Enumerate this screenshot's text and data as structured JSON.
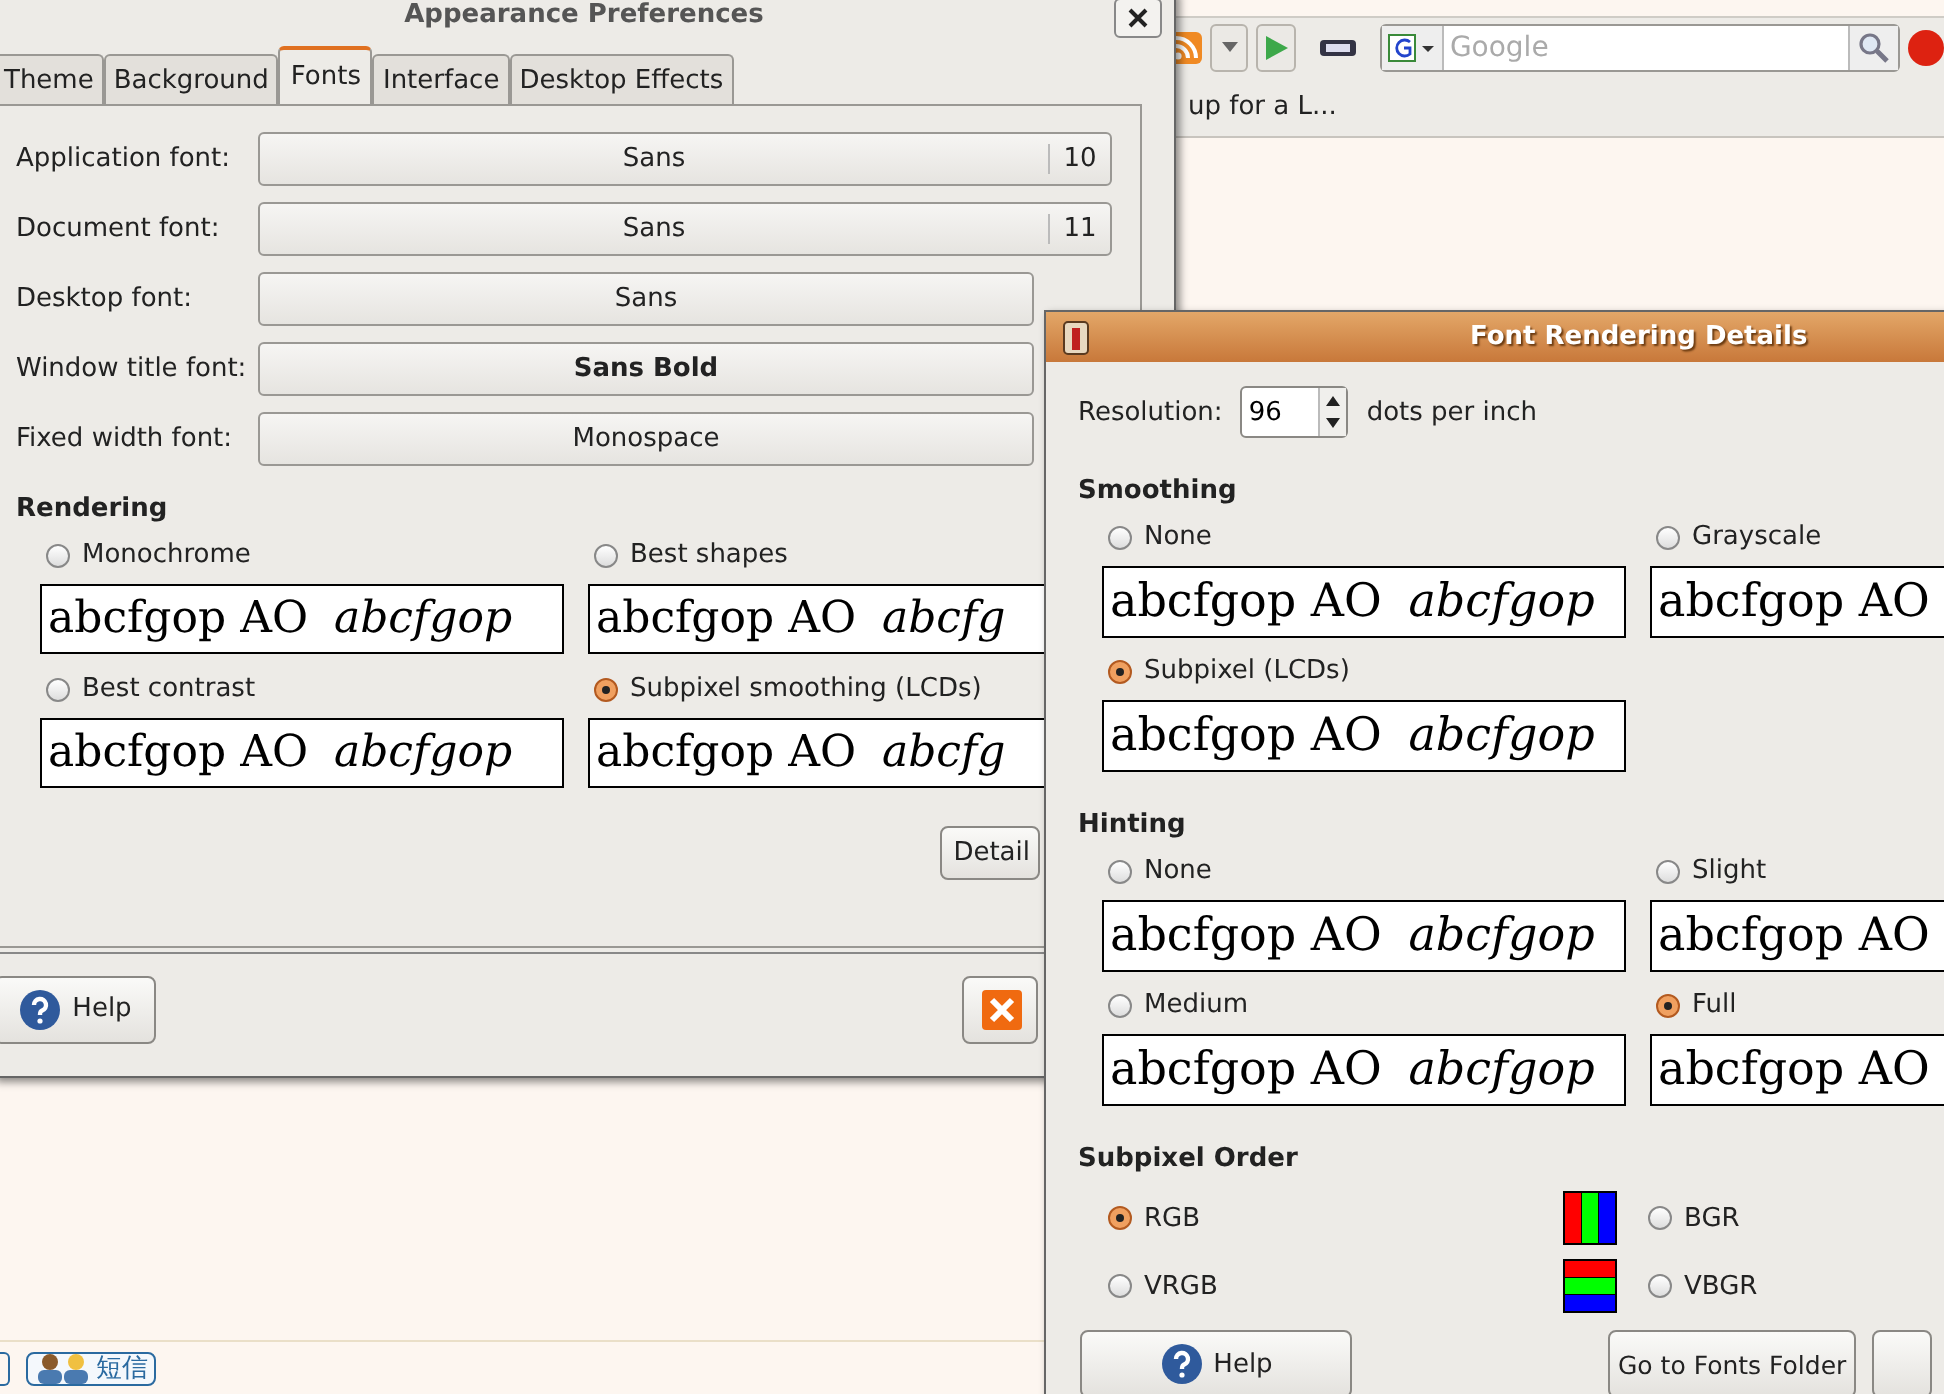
{
  "browser": {
    "search_placeholder": "Google",
    "bookmark": "up for a L...",
    "footer_button": "短信"
  },
  "prefs": {
    "title": "Appearance Preferences",
    "tabs": [
      {
        "label": "Theme",
        "selected": false
      },
      {
        "label": "Background",
        "selected": false
      },
      {
        "label": "Fonts",
        "selected": true
      },
      {
        "label": "Interface",
        "selected": false
      },
      {
        "label": "Desktop Effects",
        "selected": false
      }
    ],
    "fonts": [
      {
        "label": "Application font:",
        "value": "Sans",
        "size": "10",
        "bold": false
      },
      {
        "label": "Document font:",
        "value": "Sans",
        "size": "11",
        "bold": false
      },
      {
        "label": "Desktop font:",
        "value": "Sans",
        "bold": false
      },
      {
        "label": "Window title font:",
        "value": "Sans Bold",
        "bold": true
      },
      {
        "label": "Fixed width font:",
        "value": "Monospace",
        "bold": false
      }
    ],
    "rendering_heading": "Rendering",
    "rendering": [
      {
        "label": "Monochrome",
        "selected": false,
        "sample": "abcfgop AO",
        "sample_italic": "abcfgop"
      },
      {
        "label": "Best shapes",
        "selected": false,
        "sample": "abcfgop AO",
        "sample_italic": "abcfg"
      },
      {
        "label": "Best contrast",
        "selected": false,
        "sample": "abcfgop AO",
        "sample_italic": "abcfgop"
      },
      {
        "label": "Subpixel smoothing (LCDs)",
        "selected": true,
        "sample": "abcfgop AO",
        "sample_italic": "abcfg"
      }
    ],
    "details_button": "Detail",
    "help_button": "Help"
  },
  "details": {
    "title": "Font Rendering Details",
    "resolution_label": "Resolution:",
    "resolution": "96",
    "resolution_unit": "dots per inch",
    "sections": [
      {
        "heading": "Smoothing",
        "kind": "samples",
        "options": [
          {
            "label": "None",
            "selected": false,
            "sample": "abcfgop AO",
            "sample_italic": "abcfgop"
          },
          {
            "label": "Grayscale",
            "selected": false,
            "sample": "abcfgop AO"
          },
          {
            "label": "Subpixel (LCDs)",
            "selected": true,
            "sample": "abcfgop AO",
            "sample_italic": "abcfgop"
          }
        ]
      },
      {
        "heading": "Hinting",
        "kind": "samples",
        "options": [
          {
            "label": "None",
            "selected": false,
            "sample": "abcfgop AO",
            "sample_italic": "abcfgop"
          },
          {
            "label": "Slight",
            "selected": false,
            "sample": "abcfgop AO"
          },
          {
            "label": "Medium",
            "selected": false,
            "sample": "abcfgop AO",
            "sample_italic": "abcfgop"
          },
          {
            "label": "Full",
            "selected": true,
            "sample": "abcfgop AO"
          }
        ]
      },
      {
        "heading": "Subpixel Order",
        "kind": "order",
        "options": [
          {
            "label": "RGB",
            "selected": true
          },
          {
            "label": "BGR",
            "selected": false
          },
          {
            "label": "VRGB",
            "selected": false
          },
          {
            "label": "VBGR",
            "selected": false
          }
        ]
      }
    ],
    "buttons": [
      {
        "label": "Help",
        "kind": "help"
      },
      {
        "label": "Go to Fonts Folder",
        "kind": "plain"
      }
    ]
  }
}
